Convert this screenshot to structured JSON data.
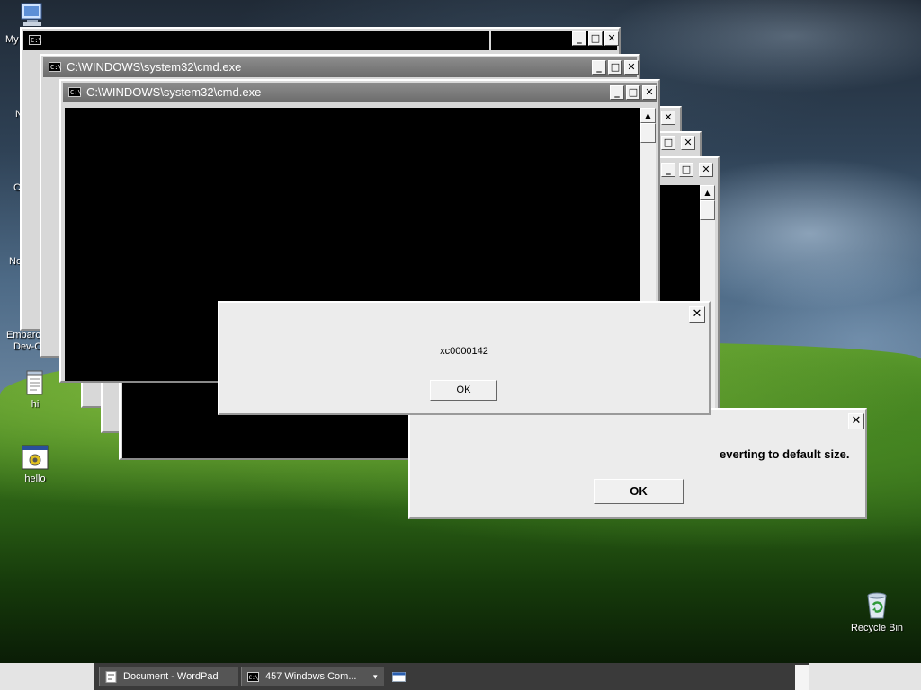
{
  "desktop": {
    "icons": [
      {
        "label": "My",
        "icon": "my-computer-icon"
      },
      {
        "label": "hi",
        "icon": "notepad-document-icon"
      },
      {
        "label": "hello",
        "icon": "executable-program-icon"
      },
      {
        "label": "Recycle Bin",
        "icon": "recycle-bin-icon"
      }
    ],
    "partial_labels": [
      "N",
      "C",
      "No"
    ],
    "embarcadero_label": [
      "Embarca",
      "Dev-C"
    ]
  },
  "windows": {
    "cmd_back": {
      "title": ""
    },
    "cmd_mid": {
      "title": "C:\\WINDOWS\\system32\\cmd.exe"
    },
    "cmd_front": {
      "title": "C:\\WINDOWS\\system32\\cmd.exe"
    },
    "cmd_icon_text": "C:\\",
    "buttons": {
      "minimize": "_",
      "maximize": "□",
      "close": "✕"
    }
  },
  "error_dialog": {
    "message": "xc0000142",
    "ok_label": "OK",
    "close_label": "✕"
  },
  "size_dialog": {
    "message": "everting to default size.",
    "ok_label": "OK",
    "close_label": "✕"
  },
  "taskbar": {
    "items": [
      {
        "label": "Document - WordPad",
        "icon": "wordpad-icon"
      },
      {
        "label": "457 Windows Com...",
        "icon": "cmd-icon",
        "menu": "▾"
      },
      {
        "label": "",
        "icon": "window-icon"
      }
    ]
  },
  "colors": {
    "console": "#000000",
    "titlebar_inactive": "#7a7a7a",
    "dialog_bg": "#ececec"
  }
}
